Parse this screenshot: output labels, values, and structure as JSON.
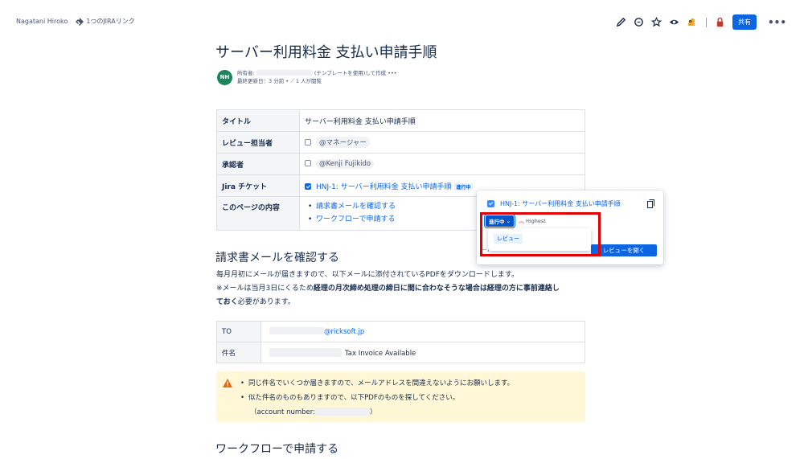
{
  "breadcrumb": {
    "author": "Nagatani Hiroko",
    "jira_links": "1つのJIRAリンク"
  },
  "toolbar": {
    "share_label": "共有",
    "more_label": "•••"
  },
  "page": {
    "title": "サーバー利用料金 支払い申請手順",
    "avatar_initials": "NH",
    "byline_owner_label": "所有者:",
    "byline_created": "(テンプレートを使用)して作成",
    "byline_more": "•••",
    "byline_updated": "最終更新日：3 分前 •",
    "byline_views": "1 人が閲覧"
  },
  "info_table": {
    "rows": [
      {
        "label": "タイトル",
        "value": "サーバー利用料金 支払い申請手順"
      },
      {
        "label": "レビュー担当者",
        "value": "@マネージャー"
      },
      {
        "label": "承認者",
        "value": "@Kenji Fujikido"
      },
      {
        "label": "Jira チケット",
        "value": "HNJ-1: サーバー利用料金 支払い申請手順",
        "status": "進行中"
      },
      {
        "label": "このページの内容",
        "items": [
          "請求書メールを確認する",
          "ワークフローで申請する"
        ]
      }
    ]
  },
  "section1": {
    "heading": "請求書メールを確認する",
    "line1": "毎月月初にメールが届きますので、以下メールに添付されているPDFをダウンロードします。",
    "line2_prefix": "※メールは当月3日にくるため",
    "line2_bold": "経理の月次締め処理の締日に間に合わなそうな場合は経理の方に事前連絡し",
    "line3_bold": "ておく",
    "line3_suffix": "必要があります。"
  },
  "mail_table": {
    "rows": [
      {
        "label": "TO",
        "value": "@ricksoft.jp"
      },
      {
        "label": "件名",
        "value": "Tax Invoice Available"
      }
    ]
  },
  "warning": {
    "item1": "同じ件名でいくつか届きますので、メールアドレスを間違えないようにお願いします。",
    "item2": "似た件名のものもありますので、以下PDFのものを探してください。",
    "item2_sub_prefix": "（account number:",
    "item2_sub_suffix": "）"
  },
  "section2": {
    "heading": "ワークフローで申請する"
  },
  "popup": {
    "title": "HNJ-1: サーバー利用料金 支払い申請手順",
    "status_label": "進行中",
    "priority_label": "Highest",
    "dropdown_option": "レビュー",
    "jira_label": "Jira",
    "open_review_label": "レビューを開く"
  },
  "colors": {
    "accent": "#0c66e4",
    "highlight": "#e30000",
    "warning_bg": "#fff7d6",
    "avatar": "#1f845a"
  }
}
